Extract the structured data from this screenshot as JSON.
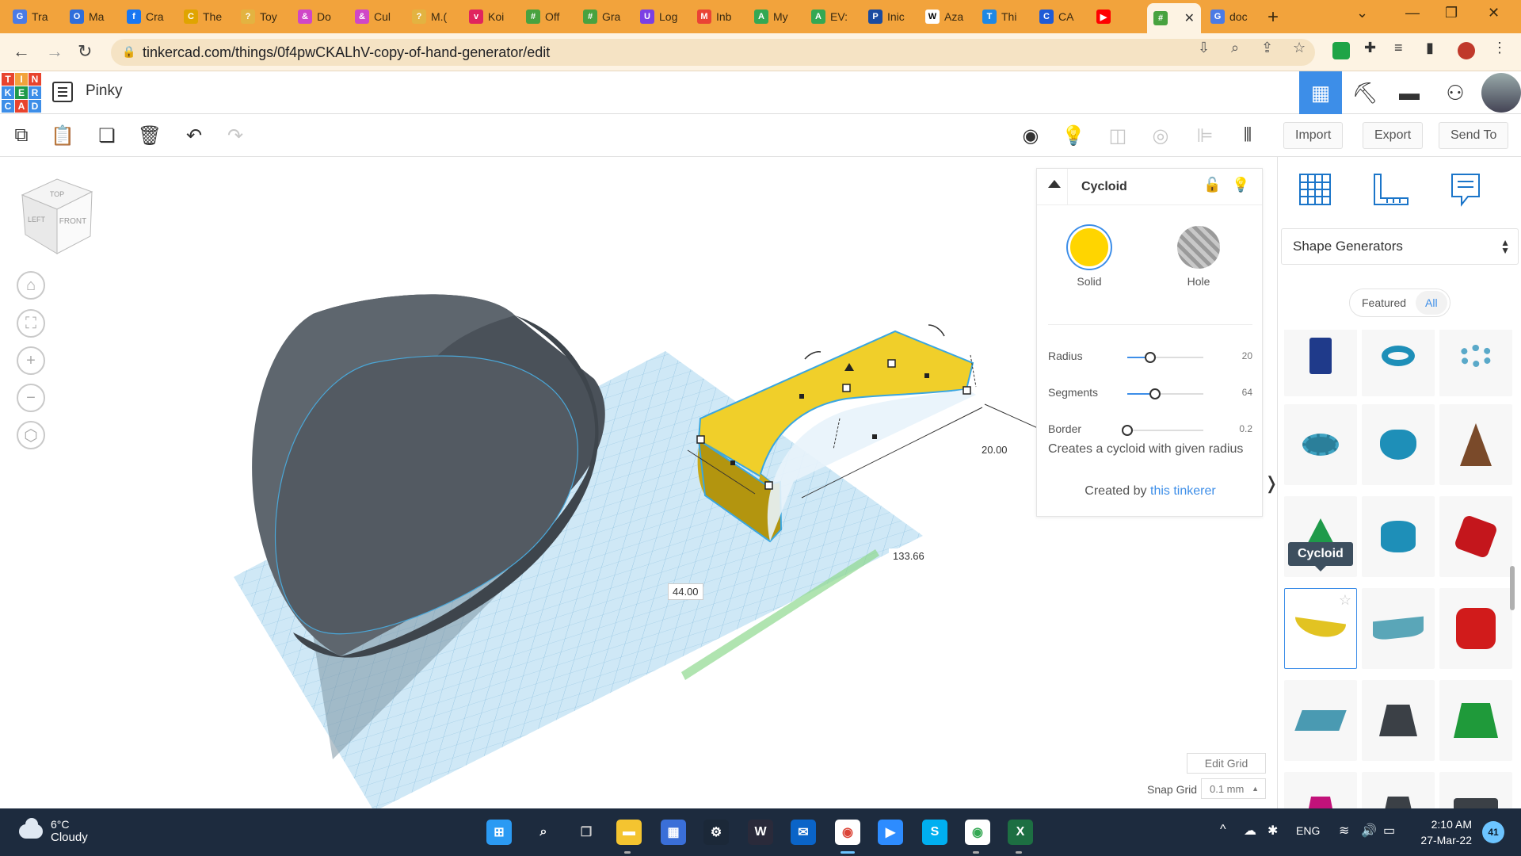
{
  "browser": {
    "tabs": [
      {
        "label": "Tra",
        "color": "#4b7be5",
        "glyph": "G"
      },
      {
        "label": "Ma",
        "color": "#2f6edb",
        "glyph": "O"
      },
      {
        "label": "Cra",
        "color": "#1877f2",
        "glyph": "f"
      },
      {
        "label": "The",
        "color": "#e0a400",
        "glyph": "C"
      },
      {
        "label": "Toy",
        "color": "#e3b341",
        "glyph": "?"
      },
      {
        "label": "Do",
        "color": "#d047c7",
        "glyph": "&"
      },
      {
        "label": "Cul",
        "color": "#d047c7",
        "glyph": "&"
      },
      {
        "label": "M.(",
        "color": "#e3b341",
        "glyph": "?"
      },
      {
        "label": "Koi",
        "color": "#e0245e",
        "glyph": "v"
      },
      {
        "label": "Off",
        "color": "#48a23f",
        "glyph": "#"
      },
      {
        "label": "Gra",
        "color": "#48a23f",
        "glyph": "#"
      },
      {
        "label": "Log",
        "color": "#7b3fe4",
        "glyph": "U"
      },
      {
        "label": "Inb",
        "color": "#ea4335",
        "glyph": "M"
      },
      {
        "label": "My",
        "color": "#34a853",
        "glyph": "A"
      },
      {
        "label": "EV:",
        "color": "#34a853",
        "glyph": "A"
      },
      {
        "label": "Inic",
        "color": "#1a4ba0",
        "glyph": "P"
      },
      {
        "label": "Aza",
        "color": "#ffffff",
        "glyph": "W"
      },
      {
        "label": "Thi",
        "color": "#1e88e5",
        "glyph": "T"
      },
      {
        "label": "CA",
        "color": "#1e5bd6",
        "glyph": "C"
      },
      {
        "label": "",
        "color": "#ff0000",
        "glyph": "▶"
      },
      {
        "label": "",
        "color": "#48a23f",
        "glyph": "#",
        "active": true
      },
      {
        "label": "doc",
        "color": "#4b7be5",
        "glyph": "G"
      }
    ],
    "url": "tinkercad.com/things/0f4pwCKALhV-copy-of-hand-generator/edit"
  },
  "tinkercad": {
    "design_name": "Pinky",
    "logo_letters": [
      "T",
      "I",
      "N",
      "K",
      "E",
      "R",
      "C",
      "A",
      "D"
    ],
    "toolbar_buttons": {
      "import": "Import",
      "export": "Export",
      "send_to": "Send To"
    }
  },
  "viewcube": {
    "top": "TOP",
    "left": "LEFT",
    "front": "FRONT"
  },
  "workplane": {
    "dimensions": {
      "width": "44.00",
      "length": "133.66",
      "height": "20.00"
    },
    "edit_grid": "Edit Grid",
    "snap_grid_label": "Snap Grid",
    "snap_grid_value": "0.1 mm"
  },
  "inspector": {
    "title": "Cycloid",
    "solid_label": "Solid",
    "hole_label": "Hole",
    "properties": [
      {
        "label": "Radius",
        "value": "20",
        "pos": 0.3
      },
      {
        "label": "Segments",
        "value": "64",
        "pos": 0.36
      },
      {
        "label": "Border",
        "value": "0.2",
        "pos": 0.0
      }
    ],
    "description": "Creates a cycloid with given radius",
    "credit_prefix": "Created by",
    "credit_link": "this tinkerer"
  },
  "library": {
    "category": "Shape Generators",
    "featured_label": "Featured",
    "all_label": "All",
    "tooltip": "Cycloid"
  },
  "taskbar": {
    "weather_temp": "6°C",
    "weather_desc": "Cloudy",
    "language": "ENG",
    "time": "2:10 AM",
    "date": "27-Mar-22",
    "notifications": "41"
  }
}
